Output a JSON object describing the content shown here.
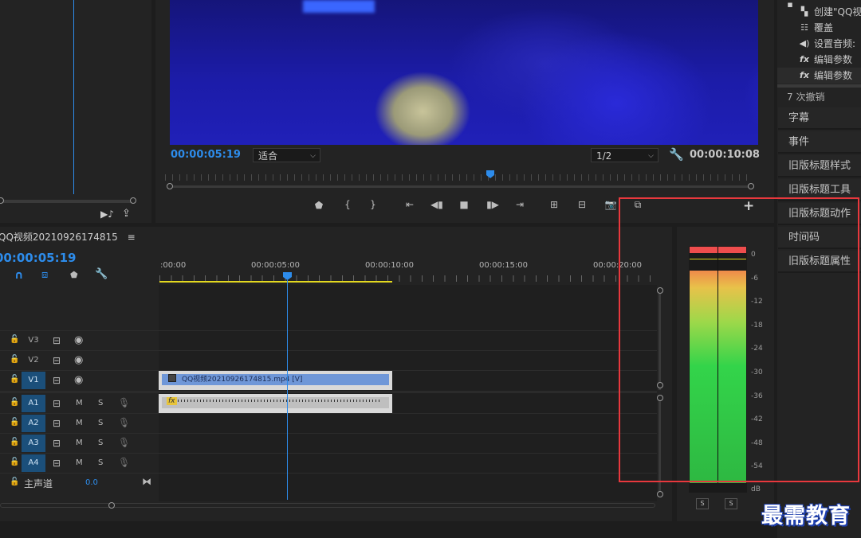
{
  "program": {
    "current_timecode": "00:00:05:19",
    "fit_label": "适合",
    "resolution": "1/2",
    "duration_timecode": "00:00:10:08"
  },
  "history": {
    "items": [
      {
        "icon": "clip-icon",
        "label": "创建\"QQ视"
      },
      {
        "icon": "list-icon",
        "label": "覆盖"
      },
      {
        "icon": "speaker-icon",
        "label": "设置音频:"
      },
      {
        "icon": "fx-icon",
        "label": "编辑参数"
      },
      {
        "icon": "fx-icon",
        "label": "编辑参数"
      }
    ],
    "undo_count": "7 次撤销"
  },
  "panels": [
    "字幕",
    "事件",
    "旧版标题样式",
    "旧版标题工具",
    "旧版标题动作",
    "时间码",
    "旧版标题属性"
  ],
  "timeline": {
    "sequence_name": "QQ视频20210926174815",
    "timecode": "00:00:05:19",
    "ruler_labels": [
      ":00:00",
      "00:00:05:00",
      "00:00:10:00",
      "00:00:15:00",
      "00:00:20:00"
    ],
    "video_tracks": [
      {
        "name": "V3",
        "active": false
      },
      {
        "name": "V2",
        "active": false
      },
      {
        "name": "V1",
        "active": true
      }
    ],
    "audio_tracks": [
      {
        "name": "A1"
      },
      {
        "name": "A2"
      },
      {
        "name": "A3"
      },
      {
        "name": "A4"
      }
    ],
    "mute_label": "M",
    "solo_label": "S",
    "master_label": "主声道",
    "master_value": "0.0",
    "video_clip_label": "QQ视频20210926174815.mp4 [V]",
    "audio_fx_label": "fx"
  },
  "meter": {
    "db_labels": [
      "0",
      "-6",
      "-12",
      "-18",
      "-24",
      "-30",
      "-36",
      "-42",
      "-48",
      "-54",
      "dB"
    ],
    "solo_left": "S",
    "solo_right": "S"
  },
  "colors": {
    "timecode_blue": "#2d8ceb",
    "highlight_red": "#e8383d",
    "track_active": "#1b4f7a",
    "clip_video": "#6f97d8",
    "meter_green": "#33d44a",
    "meter_peak": "#ef4d4d"
  },
  "watermark": "最需教育"
}
